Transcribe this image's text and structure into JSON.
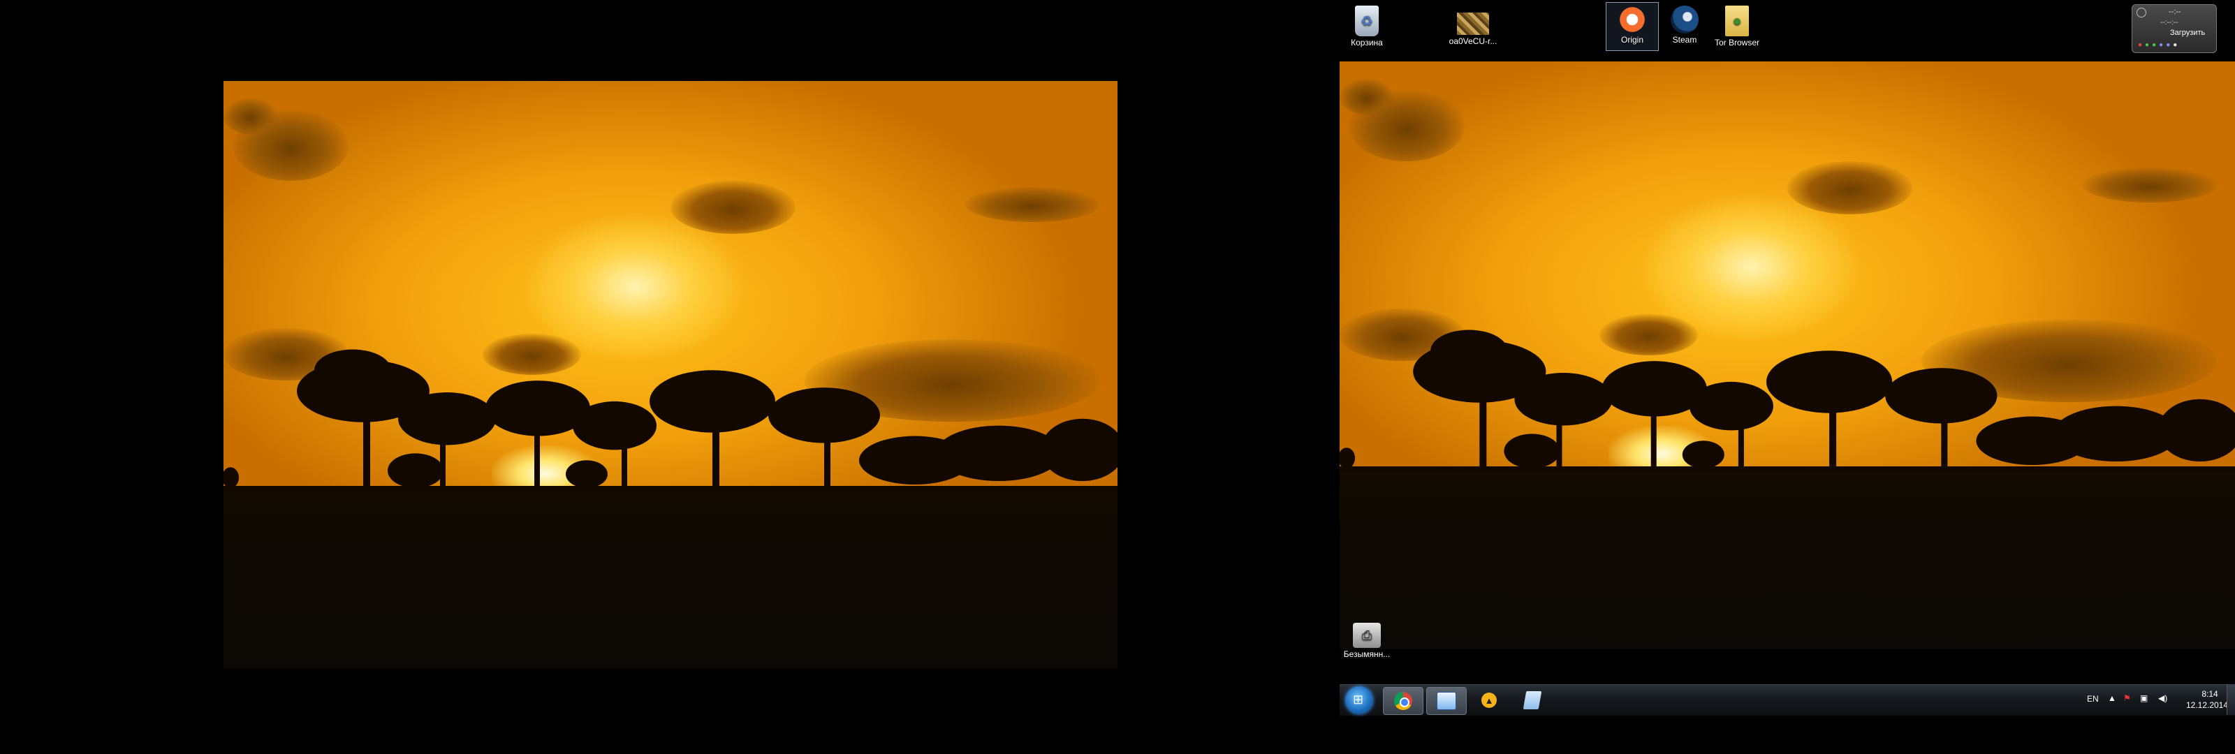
{
  "desktop": {
    "icons": [
      {
        "label": "Корзина",
        "icon": "recycle-bin-icon"
      },
      {
        "label": "oa0VeCU-r...",
        "icon": "image-file-icon"
      },
      {
        "label": "Origin",
        "icon": "origin-icon"
      },
      {
        "label": "Steam",
        "icon": "steam-icon"
      },
      {
        "label": "Tor Browser",
        "icon": "tor-browser-icon"
      },
      {
        "label": "Безымянн...",
        "icon": "printer-icon"
      }
    ]
  },
  "gadget": {
    "time_placeholder": "--:--",
    "small_text": "--:--:--",
    "button_label": "Загрузить"
  },
  "taskbar": {
    "apps": [
      "start-orb-icon",
      "chrome-icon",
      "monitor-app-icon",
      "aimp-icon",
      "notepad-icon"
    ],
    "language": "EN",
    "time": "8:14",
    "date": "12.12.2014"
  },
  "colors": {
    "sky_top": "#b96a00",
    "sky_glow": "#ffd245",
    "ground": "#0e0802",
    "taskbar": "#15181d"
  }
}
